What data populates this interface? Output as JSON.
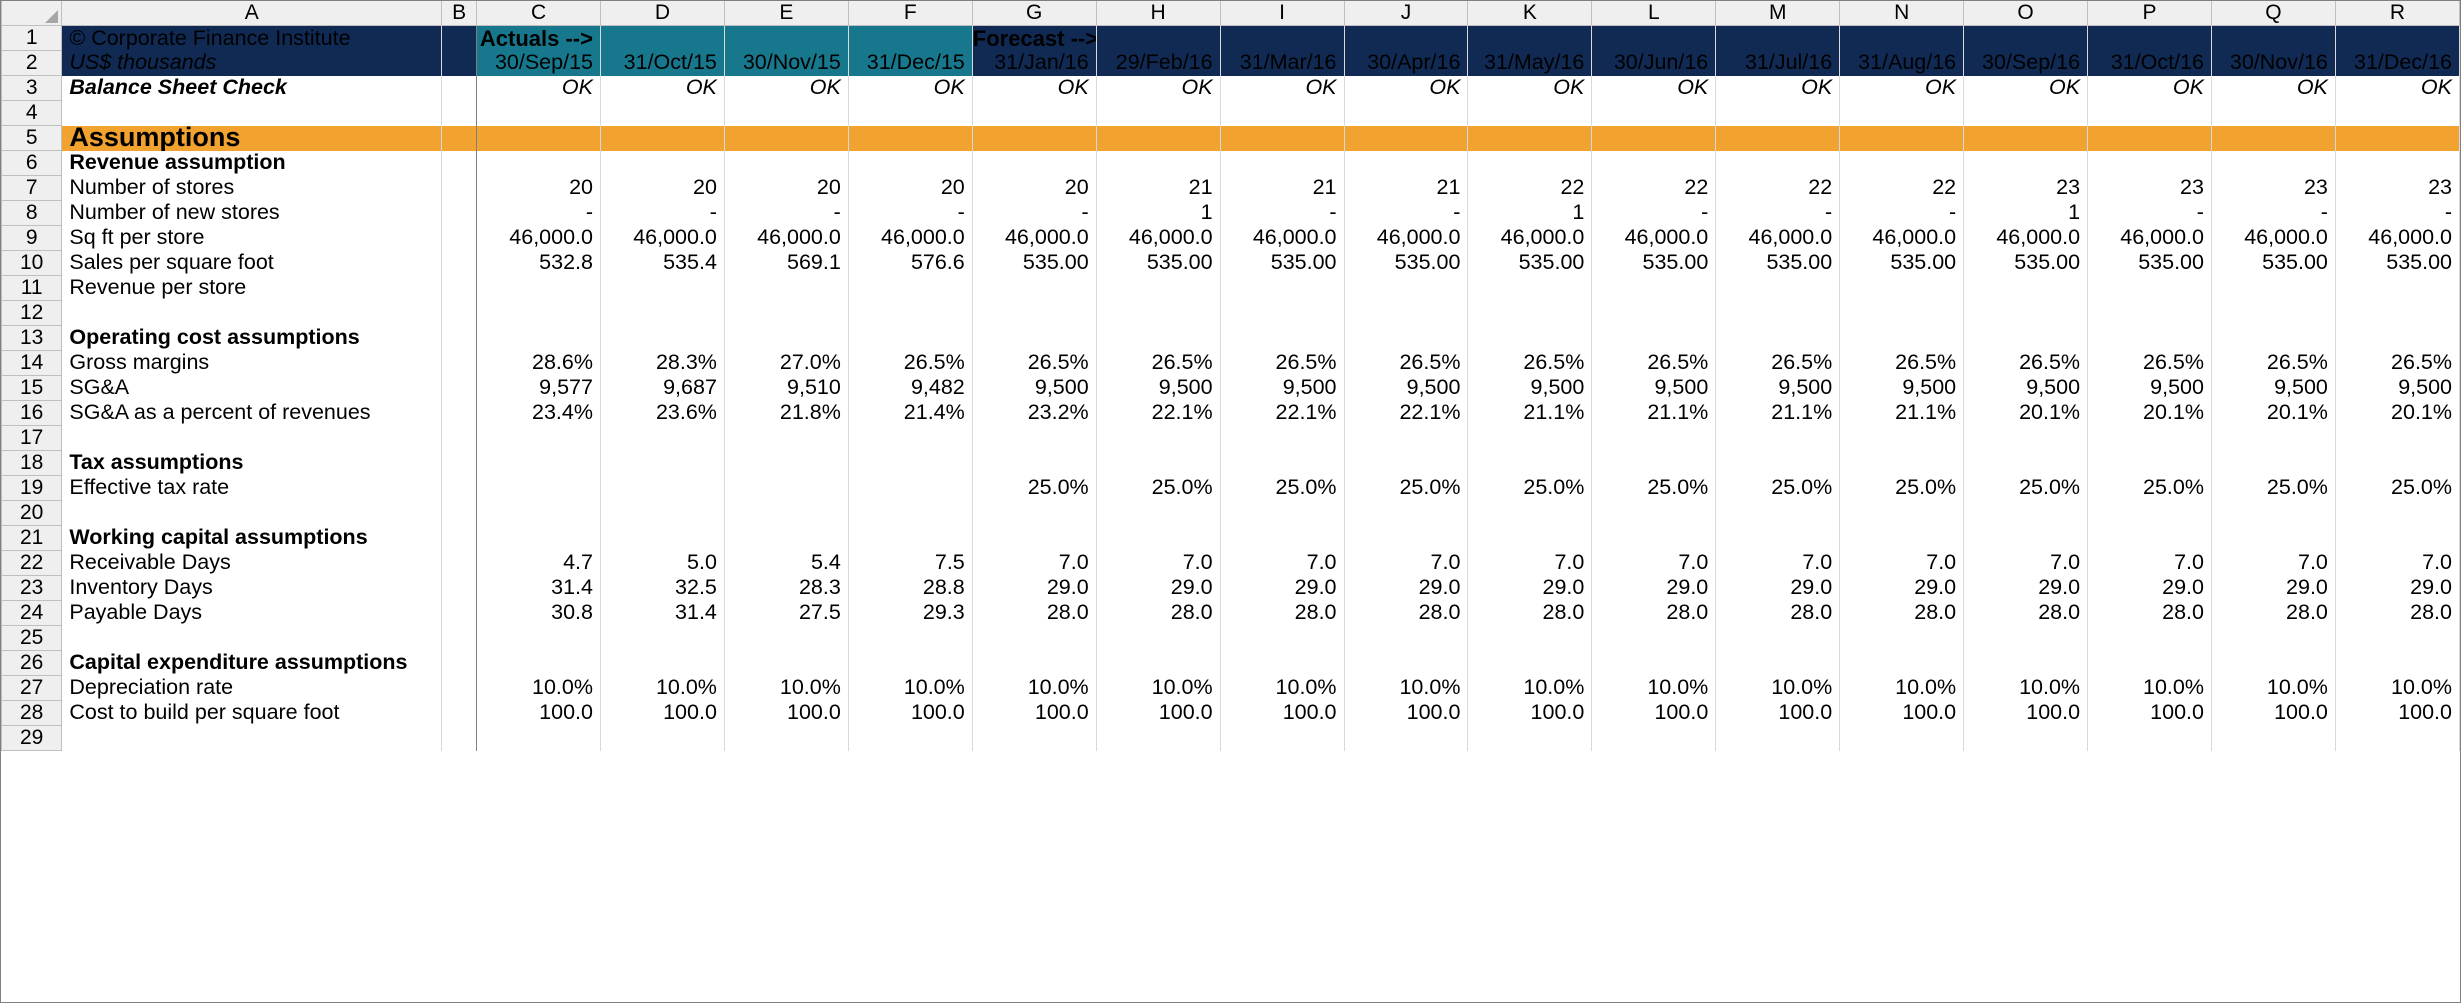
{
  "meta": {
    "copyright": "© Corporate Finance Institute",
    "units": "US$ thousands",
    "balance_check_label": "Balance Sheet Check",
    "actuals_banner": "Actuals -->",
    "forecast_banner": "Forecast -->",
    "ok_text": "OK",
    "colors": {
      "navy": "#102A54",
      "teal": "#17788D",
      "orange": "#F2A22E",
      "input_blue": "#1414D2",
      "ok_green": "#0F7A36"
    }
  },
  "column_headers": [
    "A",
    "B",
    "C",
    "D",
    "E",
    "F",
    "G",
    "H",
    "I",
    "J",
    "K",
    "L",
    "M",
    "N",
    "O",
    "P",
    "Q",
    "R"
  ],
  "row_headers": [
    "1",
    "2",
    "3",
    "4",
    "5",
    "6",
    "7",
    "8",
    "9",
    "10",
    "11",
    "12",
    "13",
    "14",
    "15",
    "16",
    "17",
    "18",
    "19",
    "20",
    "21",
    "22",
    "23",
    "24",
    "25",
    "26",
    "27",
    "28",
    "29"
  ],
  "periods": [
    {
      "col": "C",
      "date": "30/Sep/15",
      "type": "actual"
    },
    {
      "col": "D",
      "date": "31/Oct/15",
      "type": "actual"
    },
    {
      "col": "E",
      "date": "30/Nov/15",
      "type": "actual"
    },
    {
      "col": "F",
      "date": "31/Dec/15",
      "type": "actual"
    },
    {
      "col": "G",
      "date": "31/Jan/16",
      "type": "forecast"
    },
    {
      "col": "H",
      "date": "29/Feb/16",
      "type": "forecast"
    },
    {
      "col": "I",
      "date": "31/Mar/16",
      "type": "forecast"
    },
    {
      "col": "J",
      "date": "30/Apr/16",
      "type": "forecast"
    },
    {
      "col": "K",
      "date": "31/May/16",
      "type": "forecast"
    },
    {
      "col": "L",
      "date": "30/Jun/16",
      "type": "forecast"
    },
    {
      "col": "M",
      "date": "31/Jul/16",
      "type": "forecast"
    },
    {
      "col": "N",
      "date": "31/Aug/16",
      "type": "forecast"
    },
    {
      "col": "O",
      "date": "30/Sep/16",
      "type": "forecast"
    },
    {
      "col": "P",
      "date": "31/Oct/16",
      "type": "forecast"
    },
    {
      "col": "Q",
      "date": "30/Nov/16",
      "type": "forecast"
    },
    {
      "col": "R",
      "date": "31/Dec/16",
      "type": "forecast"
    }
  ],
  "balance_check_row": [
    "OK",
    "OK",
    "OK",
    "OK",
    "OK",
    "OK",
    "OK",
    "OK",
    "OK",
    "OK",
    "OK",
    "OK",
    "OK",
    "OK",
    "OK",
    "OK"
  ],
  "section_title": "Assumptions",
  "sections": [
    {
      "row": "6",
      "title": "Revenue assumption",
      "rows": [
        {
          "row": "7",
          "label": "Number of stores",
          "values": [
            "20",
            "20",
            "20",
            "20",
            "20",
            "21",
            "21",
            "21",
            "22",
            "22",
            "22",
            "22",
            "23",
            "23",
            "23",
            "23"
          ],
          "styles": [
            "blue",
            "blue",
            "blue",
            "blue",
            "blue",
            "blue",
            "blue",
            "blue",
            "blue",
            "blue",
            "blue",
            "blue",
            "blue",
            "blue",
            "blue",
            "blue"
          ]
        },
        {
          "row": "8",
          "label": "Number of new stores",
          "values": [
            "-",
            "-",
            "-",
            "-",
            "-",
            "1",
            "-",
            "-",
            "1",
            "-",
            "-",
            "-",
            "1",
            "-",
            "-",
            "-"
          ],
          "styles": [
            "blue",
            "blue",
            "blue",
            "blue",
            "blue",
            "blue",
            "blue",
            "blue",
            "blue",
            "blue",
            "blue",
            "blue",
            "blue",
            "blue",
            "blue",
            "blue"
          ]
        },
        {
          "row": "9",
          "label": "Sq ft per store",
          "values": [
            "46,000.0",
            "46,000.0",
            "46,000.0",
            "46,000.0",
            "46,000.0",
            "46,000.0",
            "46,000.0",
            "46,000.0",
            "46,000.0",
            "46,000.0",
            "46,000.0",
            "46,000.0",
            "46,000.0",
            "46,000.0",
            "46,000.0",
            "46,000.0"
          ],
          "styles": [
            "blue",
            "blue",
            "blue",
            "blue",
            "blue",
            "blue",
            "blue",
            "blue",
            "blue",
            "blue",
            "blue",
            "blue",
            "blue",
            "blue",
            "blue",
            "blue"
          ]
        },
        {
          "row": "10",
          "label": "Sales per square foot",
          "values": [
            "532.8",
            "535.4",
            "569.1",
            "576.6",
            "535.00",
            "535.00",
            "535.00",
            "535.00",
            "535.00",
            "535.00",
            "535.00",
            "535.00",
            "535.00",
            "535.00",
            "535.00",
            "535.00"
          ],
          "styles": [
            "black",
            "black",
            "black",
            "black",
            "blue",
            "blue",
            "blue",
            "blue",
            "blue",
            "blue",
            "blue",
            "blue",
            "blue",
            "blue",
            "blue",
            "blue"
          ]
        },
        {
          "row": "11",
          "label": "Revenue per store",
          "values": [
            "",
            "",
            "",
            "",
            "",
            "",
            "",
            "",
            "",
            "",
            "",
            "",
            "",
            "",
            "",
            ""
          ],
          "styles": [
            "black",
            "black",
            "black",
            "black",
            "black",
            "black",
            "black",
            "black",
            "black",
            "black",
            "black",
            "black",
            "black",
            "black",
            "black",
            "black"
          ]
        }
      ]
    },
    {
      "row": "13",
      "title": "Operating cost assumptions",
      "rows": [
        {
          "row": "14",
          "label": "Gross margins",
          "values": [
            "28.6%",
            "28.3%",
            "27.0%",
            "26.5%",
            "26.5%",
            "26.5%",
            "26.5%",
            "26.5%",
            "26.5%",
            "26.5%",
            "26.5%",
            "26.5%",
            "26.5%",
            "26.5%",
            "26.5%",
            "26.5%"
          ],
          "styles": [
            "black",
            "black",
            "black",
            "black",
            "blue",
            "blue",
            "blue",
            "blue",
            "blue",
            "blue",
            "blue",
            "blue",
            "blue",
            "blue",
            "blue",
            "blue"
          ]
        },
        {
          "row": "15",
          "label": "SG&A",
          "values": [
            "9,577",
            "9,687",
            "9,510",
            "9,482",
            "9,500",
            "9,500",
            "9,500",
            "9,500",
            "9,500",
            "9,500",
            "9,500",
            "9,500",
            "9,500",
            "9,500",
            "9,500",
            "9,500"
          ],
          "styles": [
            "black",
            "black",
            "black",
            "black",
            "blue",
            "blue",
            "blue",
            "blue",
            "blue",
            "blue",
            "blue",
            "blue",
            "blue",
            "blue",
            "blue",
            "blue"
          ]
        },
        {
          "row": "16",
          "label": "SG&A as a percent of revenues",
          "values": [
            "23.4%",
            "23.6%",
            "21.8%",
            "21.4%",
            "23.2%",
            "22.1%",
            "22.1%",
            "22.1%",
            "21.1%",
            "21.1%",
            "21.1%",
            "21.1%",
            "20.1%",
            "20.1%",
            "20.1%",
            "20.1%"
          ],
          "styles": [
            "black",
            "black",
            "black",
            "black",
            "black",
            "black",
            "black",
            "black",
            "black",
            "black",
            "black",
            "black",
            "black",
            "black",
            "black",
            "black"
          ]
        }
      ]
    },
    {
      "row": "18",
      "title": "Tax assumptions",
      "rows": [
        {
          "row": "19",
          "label": "Effective tax rate",
          "values": [
            "",
            "",
            "",
            "",
            "25.0%",
            "25.0%",
            "25.0%",
            "25.0%",
            "25.0%",
            "25.0%",
            "25.0%",
            "25.0%",
            "25.0%",
            "25.0%",
            "25.0%",
            "25.0%"
          ],
          "styles": [
            "black",
            "black",
            "black",
            "black",
            "blue",
            "blue",
            "blue",
            "blue",
            "blue",
            "blue",
            "blue",
            "blue",
            "blue",
            "blue",
            "blue",
            "blue"
          ]
        }
      ]
    },
    {
      "row": "21",
      "title": "Working capital assumptions",
      "rows": [
        {
          "row": "22",
          "label": "Receivable Days",
          "values": [
            "4.7",
            "5.0",
            "5.4",
            "7.5",
            "7.0",
            "7.0",
            "7.0",
            "7.0",
            "7.0",
            "7.0",
            "7.0",
            "7.0",
            "7.0",
            "7.0",
            "7.0",
            "7.0"
          ],
          "styles": [
            "black",
            "black",
            "black",
            "black",
            "blue",
            "blue",
            "blue",
            "blue",
            "blue",
            "blue",
            "blue",
            "blue",
            "blue",
            "blue",
            "blue",
            "blue"
          ]
        },
        {
          "row": "23",
          "label": "Inventory Days",
          "values": [
            "31.4",
            "32.5",
            "28.3",
            "28.8",
            "29.0",
            "29.0",
            "29.0",
            "29.0",
            "29.0",
            "29.0",
            "29.0",
            "29.0",
            "29.0",
            "29.0",
            "29.0",
            "29.0"
          ],
          "styles": [
            "black",
            "black",
            "black",
            "black",
            "blue",
            "blue",
            "blue",
            "blue",
            "blue",
            "blue",
            "blue",
            "blue",
            "blue",
            "blue",
            "blue",
            "blue"
          ]
        },
        {
          "row": "24",
          "label": "Payable Days",
          "values": [
            "30.8",
            "31.4",
            "27.5",
            "29.3",
            "28.0",
            "28.0",
            "28.0",
            "28.0",
            "28.0",
            "28.0",
            "28.0",
            "28.0",
            "28.0",
            "28.0",
            "28.0",
            "28.0"
          ],
          "styles": [
            "black",
            "black",
            "black",
            "black",
            "blue",
            "blue",
            "blue",
            "blue",
            "blue",
            "blue",
            "blue",
            "blue",
            "blue",
            "blue",
            "blue",
            "blue"
          ]
        }
      ]
    },
    {
      "row": "26",
      "title": "Capital expenditure assumptions",
      "rows": [
        {
          "row": "27",
          "label": "Depreciation rate",
          "values": [
            "10.0%",
            "10.0%",
            "10.0%",
            "10.0%",
            "10.0%",
            "10.0%",
            "10.0%",
            "10.0%",
            "10.0%",
            "10.0%",
            "10.0%",
            "10.0%",
            "10.0%",
            "10.0%",
            "10.0%",
            "10.0%"
          ],
          "styles": [
            "blue",
            "blue",
            "blue",
            "blue",
            "blue",
            "blue",
            "blue",
            "blue",
            "blue",
            "blue",
            "blue",
            "blue",
            "blue",
            "blue",
            "blue",
            "blue"
          ]
        },
        {
          "row": "28",
          "label": "Cost to build per square foot",
          "values": [
            "100.0",
            "100.0",
            "100.0",
            "100.0",
            "100.0",
            "100.0",
            "100.0",
            "100.0",
            "100.0",
            "100.0",
            "100.0",
            "100.0",
            "100.0",
            "100.0",
            "100.0",
            "100.0"
          ],
          "styles": [
            "blue",
            "blue",
            "blue",
            "blue",
            "blue",
            "blue",
            "blue",
            "blue",
            "blue",
            "blue",
            "blue",
            "blue",
            "blue",
            "blue",
            "blue",
            "blue"
          ]
        }
      ]
    }
  ]
}
